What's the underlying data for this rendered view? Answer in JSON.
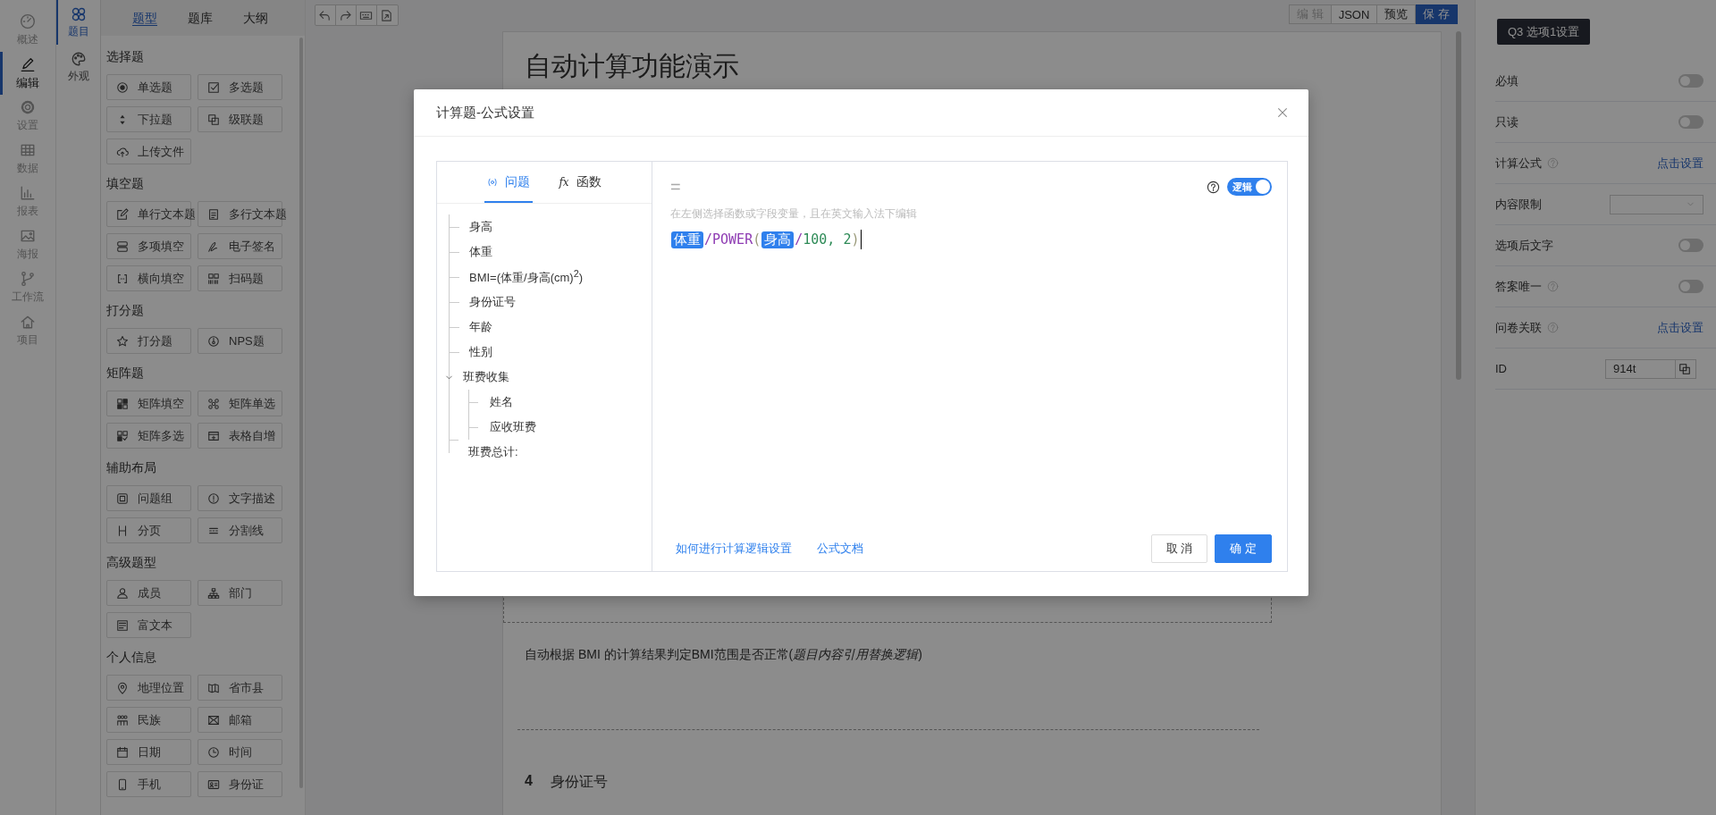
{
  "nav": [
    {
      "label": "概述",
      "selected": false
    },
    {
      "label": "编辑",
      "selected": true
    },
    {
      "label": "设置",
      "selected": false
    },
    {
      "label": "数据",
      "selected": false
    },
    {
      "label": "报表",
      "selected": false
    },
    {
      "label": "海报",
      "selected": false
    },
    {
      "label": "工作流",
      "selected": false
    },
    {
      "label": "项目",
      "selected": false
    }
  ],
  "subnav": [
    {
      "label": "题目",
      "selected": true
    },
    {
      "label": "外观",
      "selected": false
    }
  ],
  "palette": {
    "tabs": [
      {
        "label": "题型",
        "selected": true
      },
      {
        "label": "题库",
        "selected": false
      },
      {
        "label": "大纲",
        "selected": false
      }
    ],
    "groups": [
      {
        "title": "选择题",
        "items": [
          "单选题",
          "多选题",
          "下拉题",
          "级联题",
          "上传文件"
        ]
      },
      {
        "title": "填空题",
        "items": [
          "单行文本题",
          "多行文本题",
          "多项填空",
          "电子签名",
          "横向填空",
          "扫码题"
        ]
      },
      {
        "title": "打分题",
        "items": [
          "打分题",
          "NPS题"
        ]
      },
      {
        "title": "矩阵题",
        "items": [
          "矩阵填空",
          "矩阵单选",
          "矩阵多选",
          "表格自增"
        ]
      },
      {
        "title": "辅助布局",
        "items": [
          "问题组",
          "文字描述",
          "分页",
          "分割线"
        ]
      },
      {
        "title": "高级题型",
        "items": [
          "成员",
          "部门",
          "富文本"
        ]
      },
      {
        "title": "个人信息",
        "items": [
          "地理位置",
          "省市县",
          "民族",
          "邮箱",
          "日期",
          "时间",
          "手机",
          "身份证"
        ]
      }
    ]
  },
  "toolbar": {
    "mode_buttons": [
      {
        "label": "编 辑",
        "kind": "disabled"
      },
      {
        "label": "JSON",
        "kind": "default"
      },
      {
        "label": "预览",
        "kind": "default"
      },
      {
        "label": "保 存",
        "kind": "primary"
      }
    ]
  },
  "survey": {
    "title": "自动计算功能演示",
    "description": "自动根据 BMI 的计算结果判定BMI范围是否正常(*题目内容引用替换逻辑*)",
    "question": {
      "number": "4",
      "title": "身份证号"
    }
  },
  "settings_panel": {
    "header": "Q3 选项1设置",
    "rows": [
      {
        "kind": "toggle",
        "label": "必填",
        "help": false,
        "on": false
      },
      {
        "kind": "toggle",
        "label": "只读",
        "help": false,
        "on": false
      },
      {
        "kind": "link",
        "label": "计算公式",
        "help": true,
        "link": "点击设置"
      },
      {
        "kind": "select",
        "label": "内容限制",
        "help": false
      },
      {
        "kind": "toggle",
        "label": "选项后文字",
        "help": false,
        "on": false
      },
      {
        "kind": "toggle",
        "label": "答案唯一",
        "help": true,
        "on": false
      },
      {
        "kind": "link",
        "label": "问卷关联",
        "help": true,
        "link": "点击设置"
      },
      {
        "kind": "copy",
        "label": "ID",
        "help": false,
        "value": "914t"
      }
    ]
  },
  "modal": {
    "title": "计算题-公式设置",
    "tabs": [
      {
        "label": "问题",
        "selected": true
      },
      {
        "label": "函数",
        "selected": false,
        "symbol": "fx"
      }
    ],
    "tree": [
      {
        "label": "身高"
      },
      {
        "label": "体重"
      },
      {
        "label": "BMI=(体重/身高(cm)$^{2}$)"
      },
      {
        "label": "身份证号"
      },
      {
        "label": "年龄"
      },
      {
        "label": "性别"
      },
      {
        "label": "班费收集",
        "expanded": true,
        "children": [
          {
            "label": "姓名"
          },
          {
            "label": "应收班费"
          }
        ]
      },
      {
        "label": "班费总计:"
      }
    ],
    "equals": "=",
    "hint": "在左侧选择函数或字段变量，且在英文输入法下编辑",
    "logic_toggle": {
      "label": "逻辑",
      "on": true
    },
    "formula": [
      {
        "kind": "field",
        "text": "体重"
      },
      {
        "kind": "op",
        "text": "/"
      },
      {
        "kind": "func",
        "text": "POWER"
      },
      {
        "kind": "paren",
        "text": "("
      },
      {
        "kind": "field",
        "text": "身高"
      },
      {
        "kind": "op",
        "text": "/"
      },
      {
        "kind": "number",
        "text": "100, 2"
      },
      {
        "kind": "paren",
        "text": ")"
      }
    ],
    "links": [
      "如何进行计算逻辑设置",
      "公式文档"
    ],
    "buttons": [
      {
        "label": "取 消",
        "kind": "default"
      },
      {
        "label": "确 定",
        "kind": "primary"
      }
    ]
  }
}
